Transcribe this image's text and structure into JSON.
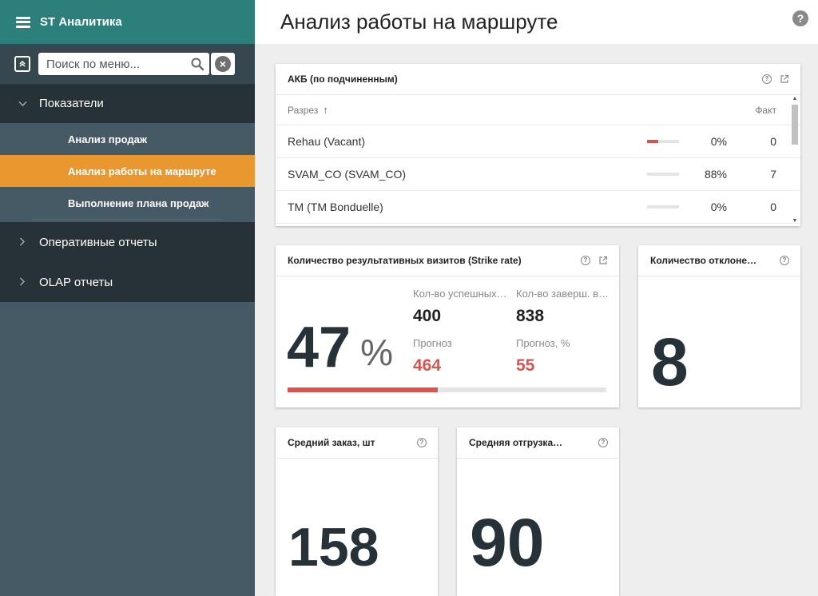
{
  "app": {
    "title": "ST Аналитика"
  },
  "search": {
    "placeholder": "Поиск по меню..."
  },
  "menu": {
    "groups": [
      {
        "label": "Показатели",
        "expanded": true,
        "items": [
          {
            "label": "Анализ продаж",
            "active": false
          },
          {
            "label": "Анализ работы на маршруте",
            "active": true
          },
          {
            "label": "Выполнение плана продаж",
            "active": false
          }
        ]
      },
      {
        "label": "Оперативные отчеты",
        "expanded": false
      },
      {
        "label": "OLAP отчеты",
        "expanded": false
      }
    ]
  },
  "page": {
    "title": "Анализ работы на маршруте",
    "help": "?"
  },
  "akb": {
    "title": "АКБ (по подчиненным)",
    "columns": {
      "dimension": "Разрез",
      "fact": "Факт"
    },
    "rows": [
      {
        "name": "Rehau (Vacant)",
        "percent": "0%",
        "fill": 0.35,
        "fact": "0"
      },
      {
        "name": "SVAM_CO (SVAM_CO)",
        "percent": "88%",
        "fill": 0,
        "fact": "7"
      },
      {
        "name": "TM (TM Bonduelle)",
        "percent": "0%",
        "fill": 0,
        "fact": "0"
      }
    ]
  },
  "strike": {
    "title": "Количество результативных визитов (Strike rate)",
    "value": "47",
    "unit": "%",
    "progress": 0.47,
    "stats": [
      {
        "label": "Кол-во успешных визитов",
        "value": "400",
        "red": false
      },
      {
        "label": "Кол-во заверш. визитов",
        "value": "838",
        "red": false
      },
      {
        "label": "Прогноз",
        "value": "464",
        "red": true
      },
      {
        "label": "Прогноз, %",
        "value": "55",
        "red": true
      }
    ]
  },
  "deviations": {
    "title": "Количество отклонений",
    "value": "8"
  },
  "avg_order": {
    "title": "Средний заказ, шт",
    "value": "158"
  },
  "avg_shipment": {
    "title": "Средняя отгрузка, шт",
    "value": "90"
  },
  "colors": {
    "brand": "#2d7f7b",
    "active": "#e8982e",
    "danger": "#d9534f",
    "sidebar": "#455a64",
    "sidebar_dark": "#263238"
  },
  "icons": {
    "menu": "hamburger-icon",
    "search": "search-icon",
    "clear": "clear-icon",
    "collapse": "collapse-icon",
    "help": "help-icon",
    "external": "external-link-icon"
  }
}
